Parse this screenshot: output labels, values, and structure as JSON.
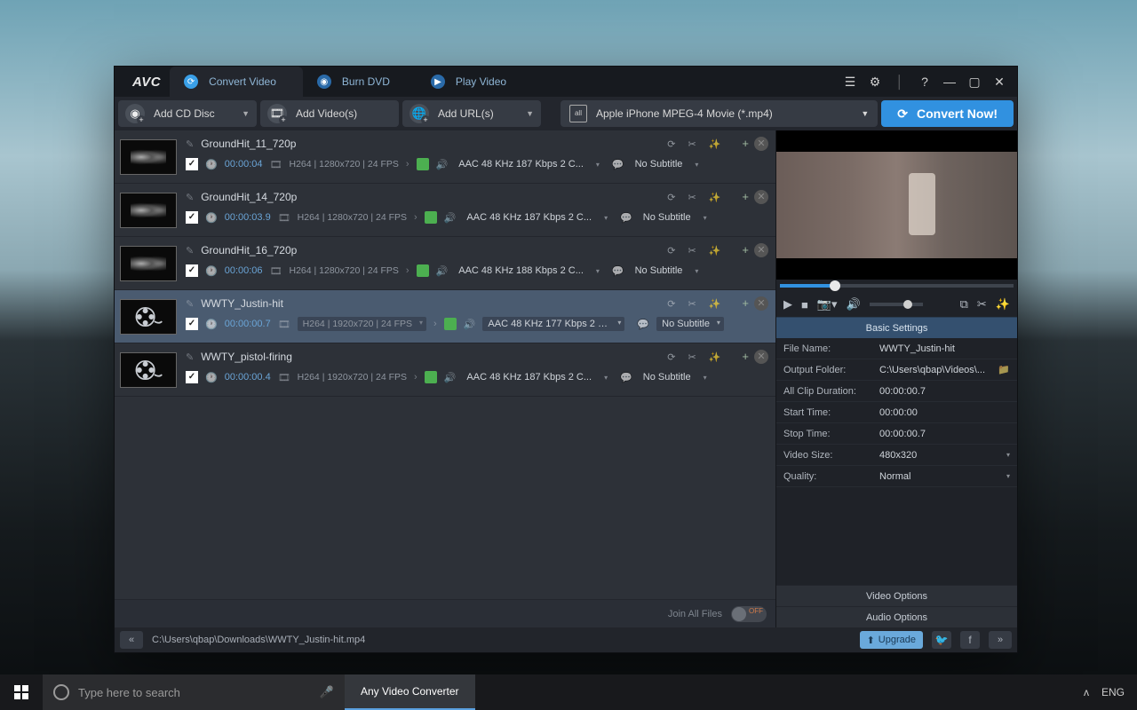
{
  "app_name": "Any Video Converter",
  "logo": "AVC",
  "tabs": [
    {
      "label": "Convert Video",
      "active": true
    },
    {
      "label": "Burn DVD",
      "active": false
    },
    {
      "label": "Play Video",
      "active": false
    }
  ],
  "toolbar": {
    "add_cd": "Add CD Disc",
    "add_videos": "Add Video(s)",
    "add_urls": "Add URL(s)",
    "profile": "Apple iPhone MPEG-4 Movie (*.mp4)",
    "all": "all",
    "convert": "Convert Now!"
  },
  "files": [
    {
      "title": "GroundHit_11_720p",
      "duration": "00:00:04",
      "codec": "H264 | 1280x720 | 24 FPS",
      "audio": "AAC 48 KHz 187 Kbps 2 C...",
      "subtitle": "No Subtitle",
      "thumb": "cloud",
      "selected": false
    },
    {
      "title": "GroundHit_14_720p",
      "duration": "00:00:03.9",
      "codec": "H264 | 1280x720 | 24 FPS",
      "audio": "AAC 48 KHz 187 Kbps 2 C...",
      "subtitle": "No Subtitle",
      "thumb": "cloud",
      "selected": false
    },
    {
      "title": "GroundHit_16_720p",
      "duration": "00:00:06",
      "codec": "H264 | 1280x720 | 24 FPS",
      "audio": "AAC 48 KHz 188 Kbps 2 C...",
      "subtitle": "No Subtitle",
      "thumb": "cloud",
      "selected": false
    },
    {
      "title": "WWTY_Justin-hit",
      "duration": "00:00:00.7",
      "codec": "H264 | 1920x720 | 24 FPS",
      "audio": "AAC 48 KHz 177 Kbps 2 C...",
      "subtitle": "No Subtitle",
      "thumb": "reel",
      "selected": true
    },
    {
      "title": "WWTY_pistol-firing",
      "duration": "00:00:00.4",
      "codec": "H264 | 1920x720 | 24 FPS",
      "audio": "AAC 48 KHz 187 Kbps 2 C...",
      "subtitle": "No Subtitle",
      "thumb": "reel",
      "selected": false
    }
  ],
  "join_label": "Join All Files",
  "join_state": "OFF",
  "settings": {
    "header": "Basic Settings",
    "rows": [
      {
        "k": "File Name:",
        "v": "WWTY_Justin-hit"
      },
      {
        "k": "Output Folder:",
        "v": "C:\\Users\\qbap\\Videos\\...",
        "folder": true
      },
      {
        "k": "All Clip Duration:",
        "v": "00:00:00.7"
      },
      {
        "k": "Start Time:",
        "v": "00:00:00"
      },
      {
        "k": "Stop Time:",
        "v": "00:00:00.7"
      },
      {
        "k": "Video Size:",
        "v": "480x320",
        "dd": true
      },
      {
        "k": "Quality:",
        "v": "Normal",
        "dd": true
      }
    ],
    "video_options": "Video Options",
    "audio_options": "Audio Options"
  },
  "status": {
    "path": "C:\\Users\\qbap\\Downloads\\WWTY_Justin-hit.mp4",
    "upgrade": "Upgrade"
  },
  "taskbar": {
    "search_placeholder": "Type here to search",
    "lang": "ENG"
  }
}
